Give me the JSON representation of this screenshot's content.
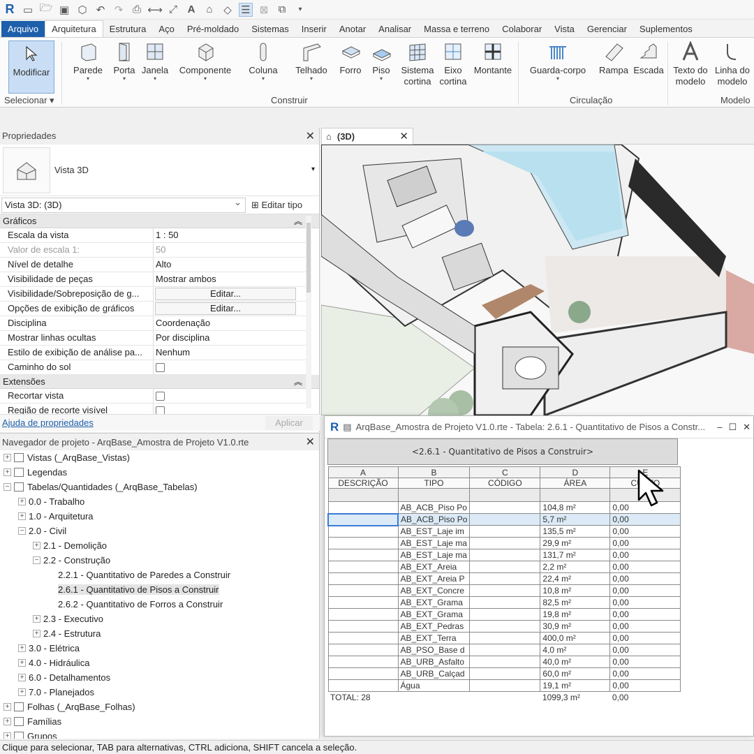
{
  "qat": {
    "logo": "R",
    "icons": [
      "folder-icon",
      "save-icon",
      "cloud-icon",
      "undo-icon",
      "redo-icon",
      "print-icon",
      "measure-icon",
      "dimension-icon",
      "text-icon",
      "3d-view-icon",
      "tag-icon",
      "thin-lines-icon",
      "close-hidden-icon",
      "switch-window-icon",
      "customize-icon"
    ]
  },
  "tabs": [
    "Arquivo",
    "Arquitetura",
    "Estrutura",
    "Aço",
    "Pré-moldado",
    "Sistemas",
    "Inserir",
    "Anotar",
    "Analisar",
    "Massa e terreno",
    "Colaborar",
    "Vista",
    "Gerenciar",
    "Suplementos"
  ],
  "ribbon": {
    "modify": "Modificar",
    "select_group": "Selecionar",
    "build_group": "Construir",
    "circulation_group": "Circulação",
    "model_group": "Modelo",
    "buttons": {
      "wall": "Parede",
      "door": "Porta",
      "window": "Janela",
      "component": "Componente",
      "column": "Coluna",
      "roof": "Telhado",
      "ceiling": "Forro",
      "floor": "Piso",
      "curtain_system": "Sistema\ncortina",
      "curtain_grid": "Eixo\ncortina",
      "mullion": "Montante",
      "railing": "Guarda-corpo",
      "ramp": "Rampa",
      "stair": "Escada",
      "model_text": "Texto do\nmodelo",
      "model_line": "Linha do\nmodelo"
    }
  },
  "properties": {
    "title": "Propriedades",
    "type_name": "Vista 3D",
    "selector": "Vista 3D: (3D)",
    "edit_type": "Editar tipo",
    "cat_graphics": "Gráficos",
    "rows": [
      {
        "k": "Escala da vista",
        "v": "1 : 50"
      },
      {
        "k": "Valor de escala    1:",
        "v": "50"
      },
      {
        "k": "Nível de detalhe",
        "v": "Alto"
      },
      {
        "k": "Visibilidade de peças",
        "v": "Mostrar ambos"
      },
      {
        "k": "Visibilidade/Sobreposição de g...",
        "v": "Editar..."
      },
      {
        "k": "Opções de exibição de gráficos",
        "v": "Editar..."
      },
      {
        "k": "Disciplina",
        "v": "Coordenação"
      },
      {
        "k": "Mostrar linhas ocultas",
        "v": "Por disciplina"
      },
      {
        "k": "Estilo de exibição de análise pa...",
        "v": "Nenhum"
      },
      {
        "k": "Caminho do sol",
        "v": ""
      }
    ],
    "cat_extents": "Extensões",
    "ext_rows": [
      {
        "k": "Recortar vista",
        "v": ""
      },
      {
        "k": "Região de recorte visível",
        "v": ""
      }
    ],
    "help_link": "Ajuda de propriedades",
    "apply": "Aplicar"
  },
  "browser": {
    "title": "Navegador de projeto - ArqBase_Amostra de Projeto V1.0.rte",
    "nodes": [
      {
        "label": "Vistas (_ArqBase_Vistas)",
        "lvl": 0,
        "t": "+",
        "icon": true
      },
      {
        "label": "Legendas",
        "lvl": 0,
        "t": "+",
        "icon": true
      },
      {
        "label": "Tabelas/Quantidades (_ArqBase_Tabelas)",
        "lvl": 0,
        "t": "−",
        "icon": true
      },
      {
        "label": "0.0 - Trabalho",
        "lvl": 1,
        "t": "+"
      },
      {
        "label": "1.0 - Arquitetura",
        "lvl": 1,
        "t": "+"
      },
      {
        "label": "2.0 - Civil",
        "lvl": 1,
        "t": "−"
      },
      {
        "label": "2.1 - Demolição",
        "lvl": 2,
        "t": "+"
      },
      {
        "label": "2.2 - Construção",
        "lvl": 2,
        "t": "−"
      },
      {
        "label": "2.2.1 - Quantitativo de Paredes a Construir",
        "lvl": 3,
        "t": ""
      },
      {
        "label": "2.6.1 - Quantitativo de Pisos  a Construir",
        "lvl": 3,
        "t": "",
        "sel": true
      },
      {
        "label": "2.6.2 - Quantitativo de Forros  a Construir",
        "lvl": 3,
        "t": ""
      },
      {
        "label": "2.3 - Executivo",
        "lvl": 2,
        "t": "+"
      },
      {
        "label": "2.4 - Estrutura",
        "lvl": 2,
        "t": "+"
      },
      {
        "label": "3.0 - Elétrica",
        "lvl": 1,
        "t": "+"
      },
      {
        "label": "4.0 - Hidráulica",
        "lvl": 1,
        "t": "+"
      },
      {
        "label": "6.0 - Detalhamentos",
        "lvl": 1,
        "t": "+"
      },
      {
        "label": "7.0 - Planejados",
        "lvl": 1,
        "t": "+"
      },
      {
        "label": "Folhas (_ArqBase_Folhas)",
        "lvl": 0,
        "t": "+",
        "icon": true
      },
      {
        "label": "Famílias",
        "lvl": 0,
        "t": "+",
        "icon": true
      },
      {
        "label": "Grupos",
        "lvl": 0,
        "t": "+",
        "icon": true
      }
    ]
  },
  "view": {
    "tab": "(3D)"
  },
  "schedule": {
    "window_title": "ArqBase_Amostra de Projeto V1.0.rte - Tabela: 2.6.1 - Quantitativo de Pisos  a Constr...",
    "heading": "<2.6.1 - Quantitativo de Pisos  a Construir>",
    "letters": [
      "A",
      "B",
      "C",
      "D",
      "E"
    ],
    "headers": [
      "DESCRIÇÃO",
      "TIPO",
      "CÓDIGO",
      "ÁREA",
      "CUSTO"
    ],
    "rows": [
      [
        "",
        "AB_ACB_Piso Po",
        "",
        "104,8 m²",
        "0,00"
      ],
      [
        "",
        "AB_ACB_Piso Po",
        "",
        "5,7 m²",
        "0,00"
      ],
      [
        "",
        "AB_EST_Laje im",
        "",
        "135,5 m²",
        "0,00"
      ],
      [
        "",
        "AB_EST_Laje ma",
        "",
        "29,9 m²",
        "0,00"
      ],
      [
        "",
        "AB_EST_Laje ma",
        "",
        "131,7 m²",
        "0,00"
      ],
      [
        "",
        "AB_EXT_Areia",
        "",
        "2,2 m²",
        "0,00"
      ],
      [
        "",
        "AB_EXT_Areia P",
        "",
        "22,4 m²",
        "0,00"
      ],
      [
        "",
        "AB_EXT_Concre",
        "",
        "10,8 m²",
        "0,00"
      ],
      [
        "",
        "AB_EXT_Grama",
        "",
        "82,5 m²",
        "0,00"
      ],
      [
        "",
        "AB_EXT_Grama",
        "",
        "19,8 m²",
        "0,00"
      ],
      [
        "",
        "AB_EXT_Pedras",
        "",
        "30,9 m²",
        "0,00"
      ],
      [
        "",
        "AB_EXT_Terra",
        "",
        "400,0 m²",
        "0,00"
      ],
      [
        "",
        "AB_PSO_Base d",
        "",
        "4,0 m²",
        "0,00"
      ],
      [
        "",
        "AB_URB_Asfalto",
        "",
        "40,0 m²",
        "0,00"
      ],
      [
        "",
        "AB_URB_Calçad",
        "",
        "60,0 m²",
        "0,00"
      ],
      [
        "",
        "Água",
        "",
        "19,1 m²",
        "0,00"
      ]
    ],
    "total_label": "TOTAL: 28",
    "total_area": "1099,3 m²",
    "total_cost": "0,00"
  },
  "status": "Clique para selecionar, TAB para alternativas, CTRL adiciona, SHIFT cancela a seleção.",
  "colors": {
    "accent": "#1d5fab",
    "selection": "#c9def5",
    "highlight_row": "#dbeaf6"
  }
}
